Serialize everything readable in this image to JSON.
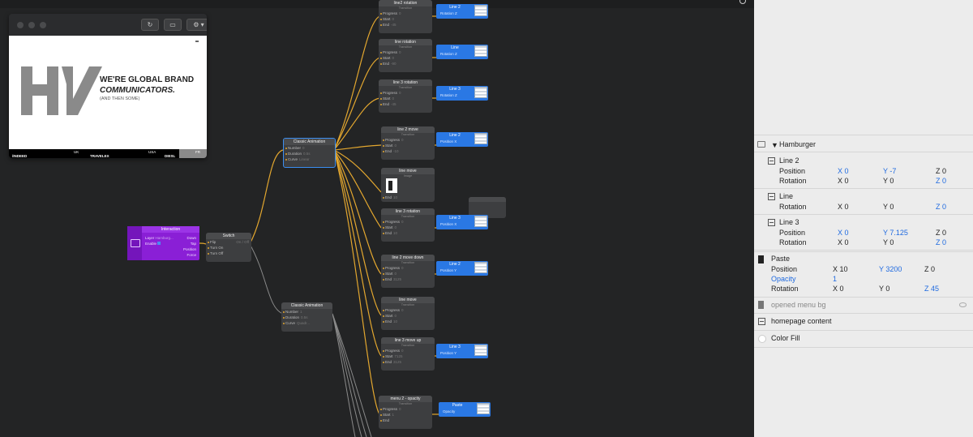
{
  "viewer": {
    "tagline_line1": "WE'RE GLOBAL BRAND",
    "tagline_line2": "COMMUNICATORS.",
    "tagline_line3": "(AND THEN SOME)",
    "footer_left": "/INDEED",
    "footer_uk": "UK",
    "footer_travelex": "TRAVELEX",
    "footer_usa": "USA",
    "footer_diesel": "DIESL",
    "footer_fr": "FR",
    "refresh_icon": "refresh-icon",
    "camera_icon": "camera-icon",
    "gear_icon": "gear-icon"
  },
  "nodes": {
    "interaction": {
      "title": "Interaction",
      "layer": "Layer",
      "layer_val": "Hamburg...",
      "enable": "Enable",
      "down": "Down",
      "tap": "Tap",
      "position": "Position",
      "force": "Force"
    },
    "switch": {
      "title": "Switch",
      "flip": "Flip",
      "on_off": "On / Off",
      "turn_on": "Turn On",
      "turn_off": "Turn Off"
    },
    "classic1": {
      "title": "Classic Animation",
      "number": "Number",
      "number_val": "0",
      "duration": "Duration",
      "duration_val": "0.5s",
      "curve": "Curve",
      "curve_val": "Linear"
    },
    "classic2": {
      "title": "Classic Animation",
      "number": "Number",
      "number_val": "1",
      "duration": "Duration",
      "duration_val": "0.5s",
      "curve": "Curve",
      "curve_val": "Quadr..."
    },
    "transitions": [
      {
        "title": "line2 rotation",
        "sub": "Transition",
        "p1": "Progress",
        "p1v": "0",
        "p2": "Start",
        "p2v": "0",
        "p3": "End",
        "p3v": "-45"
      },
      {
        "title": "line rotation",
        "sub": "Transition",
        "p1": "Progress",
        "p1v": "0",
        "p2": "Start",
        "p2v": "0",
        "p3": "End",
        "p3v": "-90"
      },
      {
        "title": "line 3 rotation",
        "sub": "Transition",
        "p1": "Progress",
        "p1v": "0",
        "p2": "Start",
        "p2v": "0",
        "p3": "End",
        "p3v": "-45"
      },
      {
        "title": "line 2 move",
        "sub": "Transition",
        "p1": "Progress",
        "p1v": "0",
        "p2": "Start",
        "p2v": "0",
        "p3": "End",
        "p3v": "-10"
      },
      {
        "title": "line 3 rotation",
        "sub": "Transition",
        "p1": "Progress",
        "p1v": "0",
        "p2": "Start",
        "p2v": "0",
        "p3": "End",
        "p3v": "10"
      },
      {
        "title": "line 2 move down",
        "sub": "Transition",
        "p1": "Progress",
        "p1v": "0",
        "p2": "Start",
        "p2v": "0",
        "p3": "End",
        "p3v": "3125"
      },
      {
        "title": "line move",
        "sub": "Transition",
        "p1": "Progress",
        "p1v": "0",
        "p2": "Start",
        "p2v": "0",
        "p3": "End",
        "p3v": "10"
      },
      {
        "title": "line 3 move up",
        "sub": "Transition",
        "p1": "Progress",
        "p1v": "0",
        "p2": "Start",
        "p2v": "7125",
        "p3": "End",
        "p3v": "3125"
      },
      {
        "title": "menu 2 - opacity",
        "sub": "Transition",
        "p1": "Progress",
        "p1v": "0",
        "p2": "Start",
        "p2v": "1",
        "p3": "End",
        "p3v": ""
      }
    ],
    "line_move_image": {
      "title": "line move",
      "sub": "Image",
      "end": "End",
      "end_val": "10"
    },
    "outputs": [
      {
        "title": "Line 2",
        "port": "Rotation Z"
      },
      {
        "title": "Line",
        "port": "Rotation Z"
      },
      {
        "title": "Line 3",
        "port": "Rotation Z"
      },
      {
        "title": "Line 2",
        "port": "Position X"
      },
      {
        "title": "Line 3",
        "port": "Position X"
      },
      {
        "title": "Line 2",
        "port": "Position Y"
      },
      {
        "title": "Line 3",
        "port": "Position Y"
      },
      {
        "title": "Paste",
        "port": "Opacity"
      }
    ]
  },
  "inspector": {
    "root": "Hamburger",
    "layers": [
      {
        "name": "Line 2",
        "props": [
          {
            "label": "Position",
            "x": "X 0",
            "y": "Y -7",
            "z": "Z 0",
            "xb": true,
            "yb": true,
            "zb": false
          },
          {
            "label": "Rotation",
            "x": "X 0",
            "y": "Y 0",
            "z": "Z 0",
            "xb": false,
            "yb": false,
            "zb": true
          }
        ]
      },
      {
        "name": "Line",
        "props": [
          {
            "label": "Rotation",
            "x": "X 0",
            "y": "Y 0",
            "z": "Z 0",
            "xb": false,
            "yb": false,
            "zb": true
          }
        ]
      },
      {
        "name": "Line 3",
        "props": [
          {
            "label": "Position",
            "x": "X 0",
            "y": "Y 7.125",
            "z": "Z 0",
            "xb": true,
            "yb": true,
            "zb": false
          },
          {
            "label": "Rotation",
            "x": "X 0",
            "y": "Y 0",
            "z": "Z 0",
            "xb": false,
            "yb": false,
            "zb": true
          }
        ]
      }
    ],
    "paste": {
      "name": "Paste",
      "position": {
        "label": "Position",
        "x": "X 10",
        "y": "Y 3200",
        "z": "Z 0"
      },
      "opacity": {
        "label": "Opacity",
        "value": "1"
      },
      "rotation": {
        "label": "Rotation",
        "x": "X 0",
        "y": "Y 0",
        "z": "Z 45"
      }
    },
    "opened_menu_bg": "opened menu bg",
    "homepage_content": "homepage content",
    "color_fill": "Color Fill",
    "search_icon": "search-icon"
  }
}
